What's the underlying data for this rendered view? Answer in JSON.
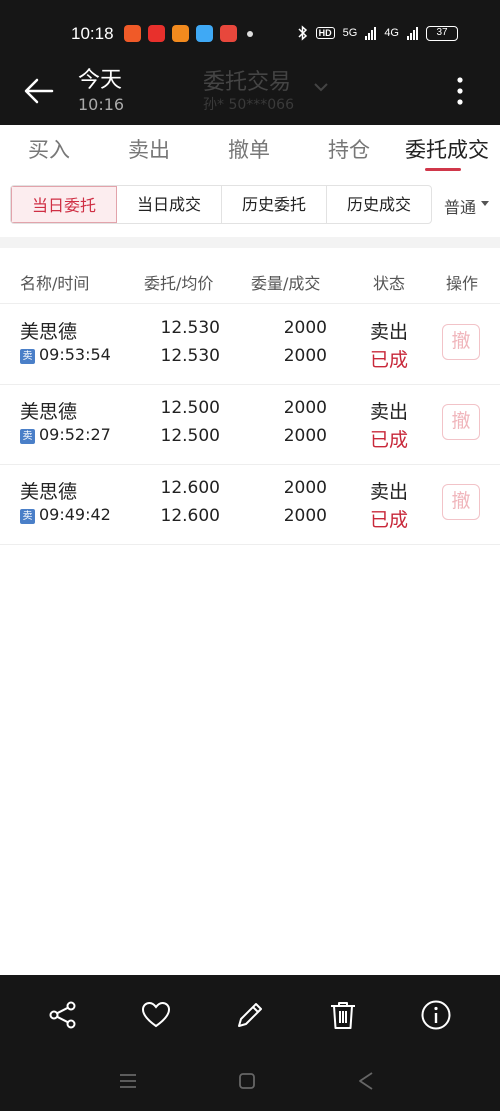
{
  "status_bar": {
    "time": "10:18",
    "app_icons": [
      "app-icon-1",
      "app-icon-2",
      "app-icon-3",
      "app-icon-4",
      "app-icon-5"
    ],
    "network_left": "5G",
    "network_right": "4G",
    "battery": "37"
  },
  "header": {
    "title": "今天",
    "subtitle": "10:16",
    "ghost_title": "委托交易",
    "ghost_account": "孙* 50***066"
  },
  "tabs": [
    "买入",
    "卖出",
    "撤单",
    "持仓",
    "委托成交"
  ],
  "active_tab": "委托成交",
  "subtabs": [
    "当日委托",
    "当日成交",
    "历史委托",
    "历史成交"
  ],
  "active_subtab": "当日委托",
  "type_filter": "普通",
  "table": {
    "headers": [
      "名称/时间",
      "委托/均价",
      "委量/成交",
      "状态",
      "操作"
    ],
    "rows": [
      {
        "name": "美思德",
        "side_badge": "卖",
        "time": "09:53:54",
        "order_price": "12.530",
        "avg_price": "12.530",
        "order_qty": "2000",
        "filled_qty": "2000",
        "side": "卖出",
        "status": "已成",
        "action": "撤"
      },
      {
        "name": "美思德",
        "side_badge": "卖",
        "time": "09:52:27",
        "order_price": "12.500",
        "avg_price": "12.500",
        "order_qty": "2000",
        "filled_qty": "2000",
        "side": "卖出",
        "status": "已成",
        "action": "撤"
      },
      {
        "name": "美思德",
        "side_badge": "卖",
        "time": "09:49:42",
        "order_price": "12.600",
        "avg_price": "12.600",
        "order_qty": "2000",
        "filled_qty": "2000",
        "side": "卖出",
        "status": "已成",
        "action": "撤"
      }
    ]
  },
  "colors": {
    "accent": "#cf2f44",
    "status_done": "#c8283a",
    "dark_bar": "#161616",
    "badge_sell": "#4a7fc8"
  },
  "bottom_toolbar": [
    "share-icon",
    "heart-icon",
    "edit-icon",
    "trash-icon",
    "info-icon"
  ],
  "system_nav": [
    "menu-icon",
    "home-icon",
    "back-icon"
  ]
}
